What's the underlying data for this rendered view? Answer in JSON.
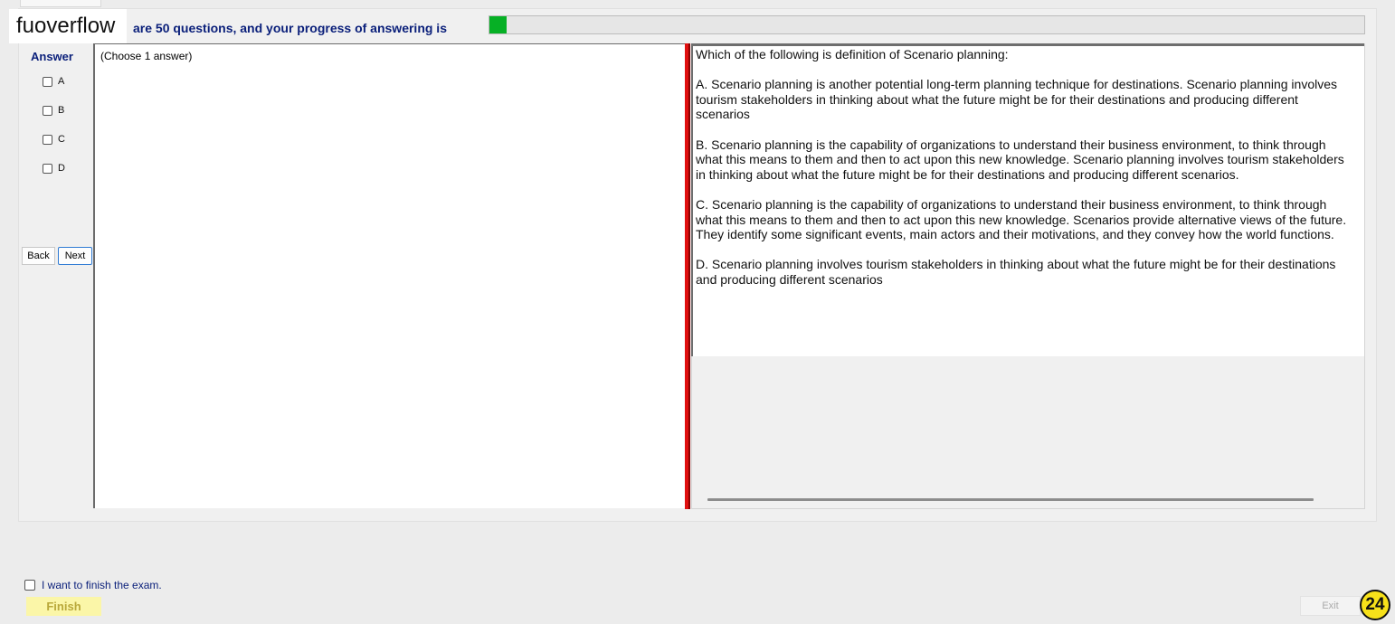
{
  "watermark": {
    "text": "fuoverflow"
  },
  "header": {
    "progress_text": "are 50 questions, and your progress of answering is",
    "progress_fraction": 0.02,
    "progress_color": "#06b025"
  },
  "answer_panel": {
    "heading": "Answer",
    "options": [
      "A",
      "B",
      "C",
      "D"
    ],
    "hint": "(Choose 1 answer)"
  },
  "nav": {
    "back": "Back",
    "next": "Next"
  },
  "question": {
    "stem": "Which of the following is definition of Scenario planning:",
    "choices": [
      "A.  Scenario planning is another potential long-term planning technique for destinations. Scenario planning involves tourism stakeholders in thinking about what the future might be for their destinations and producing different scenarios",
      "B.  Scenario planning is the capability of organizations to understand their business environment, to think through what this means to them and then to act upon this new knowledge. Scenario planning involves tourism stakeholders in thinking about what the future might be for their destinations and producing different scenarios.",
      "C.  Scenario planning is the capability of organizations to understand their business environment, to think through what this means to them and then to act upon this new knowledge. Scenarios provide alternative views of the future. They identify some significant events, main actors and their motivations, and they convey how the world functions.",
      "D.  Scenario planning involves tourism stakeholders in thinking about what the future might be for their destinations and producing different scenarios"
    ]
  },
  "footer": {
    "finish_checkbox_label": "I want to finish the exam.",
    "finish_button": "Finish",
    "exit_button": "Exit",
    "page_badge": "24"
  },
  "colors": {
    "accent_text": "#0a1f7a",
    "splitter": "#e01010",
    "finish_bg": "#fbf6a8",
    "badge_bg": "#f7e11a"
  }
}
